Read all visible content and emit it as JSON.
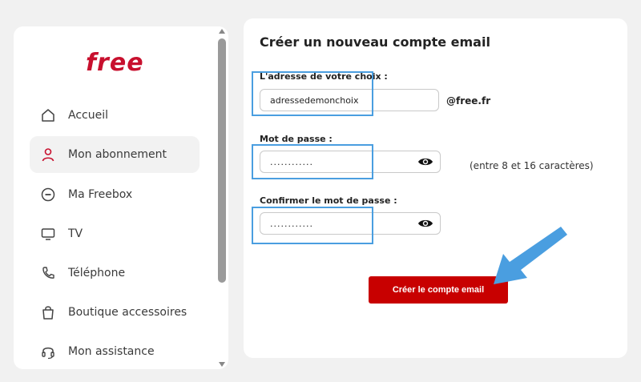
{
  "brand": {
    "logo_text": "free",
    "color": "#c8102e"
  },
  "sidebar": {
    "items": [
      {
        "label": "Accueil",
        "icon": "home-icon",
        "active": false
      },
      {
        "label": "Mon abonnement",
        "icon": "user-icon",
        "active": true
      },
      {
        "label": "Ma Freebox",
        "icon": "freebox-icon",
        "active": false
      },
      {
        "label": "TV",
        "icon": "tv-icon",
        "active": false
      },
      {
        "label": "Téléphone",
        "icon": "phone-icon",
        "active": false
      },
      {
        "label": "Boutique accessoires",
        "icon": "shopping-bag-icon",
        "active": false
      },
      {
        "label": "Mon assistance",
        "icon": "headset-icon",
        "active": false
      }
    ]
  },
  "form": {
    "title": "Créer un nouveau compte email",
    "address_label": "L'adresse de votre choix :",
    "address_value": "adressedemonchoix",
    "domain_suffix": "@free.fr",
    "password_label": "Mot de passe :",
    "password_value": "............",
    "password_hint": "(entre 8 et 16 caractères)",
    "confirm_label": "Confirmer le mot de passe :",
    "confirm_value": "............",
    "submit_label": "Créer le compte email"
  },
  "colors": {
    "accent": "#c80000",
    "highlight": "#4a9ee0",
    "arrow": "#4a9ee0"
  }
}
